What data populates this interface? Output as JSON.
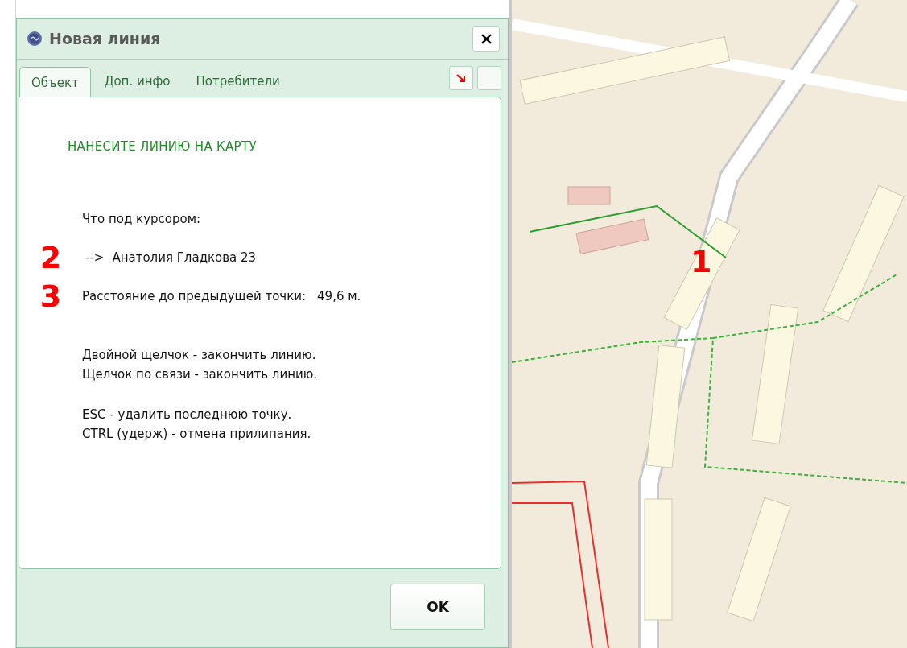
{
  "dialog": {
    "title": "Новая линия",
    "tabs": [
      {
        "label": "Объект",
        "selected": true
      },
      {
        "label": "Доп. инфо",
        "selected": false
      },
      {
        "label": "Потребители",
        "selected": false
      }
    ],
    "heading": "НАНЕСИТЕ ЛИНИЮ НА КАРТУ",
    "lines": [
      {
        "kind": "label",
        "text": "Что под курсором:"
      },
      {
        "kind": "target",
        "marker": "2",
        "arrow": "-->",
        "text": "Анатолия Гладкова 23"
      },
      {
        "kind": "distance",
        "marker": "3",
        "text": "Расстояние до предыдущей точки:",
        "value": "49,6 м."
      }
    ],
    "hints": [
      [
        "Двойной щелчок - закончить линию.",
        "Щелчок по связи - закончить линию."
      ],
      [
        "ESC - удалить последнюю точку.",
        "CTRL (удерж) - отмена прилипания."
      ]
    ],
    "ok_button": "OK"
  },
  "map": {
    "kind": "picture",
    "marker": "1"
  }
}
